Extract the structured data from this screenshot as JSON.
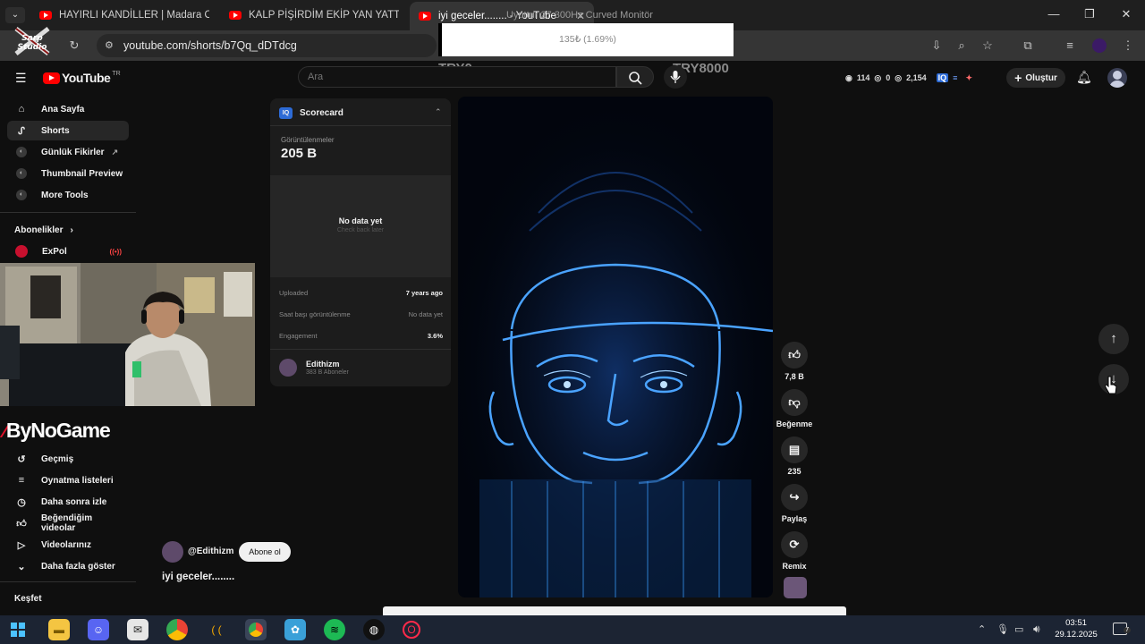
{
  "browser": {
    "tabs": [
      {
        "title": "HAYIRLI KANDİLLER | Madara O"
      },
      {
        "title": "KALP PİŞİRDİM EKİP YAN YATTI"
      },
      {
        "title": "iyi geceler........ - YouTube"
      }
    ],
    "overlay_tab_text": "Uyuttur 27 300Hz Curved Monitör",
    "url": "youtube.com/shorts/b7Qq_dDTdcg"
  },
  "overlay": {
    "donation_progress": "135₺ (1.69%)",
    "goal_start": "TRY0",
    "goal_end": "TRY8000",
    "stream_logo_text": "Sarp Studio"
  },
  "youtube": {
    "logo": "YouTube",
    "country": "TR",
    "search_placeholder": "Ara",
    "create_label": "Oluştur",
    "stats": {
      "views": "114",
      "zero": "0",
      "count": "2,154"
    }
  },
  "sidebar": {
    "main": [
      {
        "label": "Ana Sayfa",
        "icon": "home-icon"
      },
      {
        "label": "Shorts",
        "icon": "shorts-icon"
      },
      {
        "label": "Günlük Fikirler",
        "icon": "ext-icon"
      },
      {
        "label": "Thumbnail Preview",
        "icon": "ext-icon"
      },
      {
        "label": "More Tools",
        "icon": "ext-icon"
      }
    ],
    "subs_header": "Abonelikler",
    "subs": [
      {
        "label": "ExPol"
      }
    ],
    "brand": "ByNoGame",
    "you": [
      {
        "label": "Geçmiş",
        "icon": "history-icon"
      },
      {
        "label": "Oynatma listeleri",
        "icon": "playlist-icon"
      },
      {
        "label": "Daha sonra izle",
        "icon": "clock-icon"
      },
      {
        "label": "Beğendiğim videolar",
        "icon": "like-icon"
      },
      {
        "label": "Videolarınız",
        "icon": "video-icon"
      },
      {
        "label": "Daha fazla göster",
        "icon": "chevron-down-icon"
      }
    ],
    "explore_header": "Keşfet"
  },
  "scorecard": {
    "title": "Scorecard",
    "views_label": "Görüntülenmeler",
    "views_value": "205 B",
    "no_data": "No data yet",
    "no_data_sub": "Check back later",
    "rows": [
      {
        "label": "Uploaded",
        "value": "7 years ago"
      },
      {
        "label": "Saat başı görüntülenme",
        "value": "No data yet"
      },
      {
        "label": "Engagement",
        "value": "3.6%"
      }
    ],
    "channel_name": "Edithizm",
    "channel_subs": "383 B Aboneler"
  },
  "short": {
    "channel": "@Edithizm",
    "subscribe": "Abone ol",
    "title": "iyi geceler........",
    "likes": "7,8 B",
    "dislike_label": "Beğenme",
    "comments": "235",
    "share_label": "Paylaş",
    "remix_label": "Remix"
  },
  "taskbar": {
    "time": "03:51",
    "date": "29.12.2025",
    "notifications": "7"
  }
}
